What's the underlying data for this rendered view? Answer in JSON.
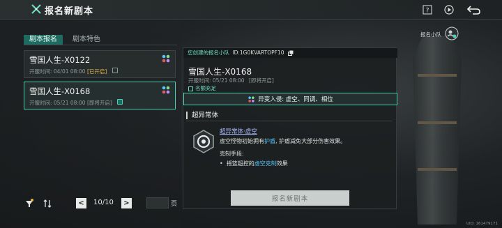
{
  "header": {
    "title": "报名新剧本",
    "help_label": "?",
    "icons": [
      "logo-icon",
      "help-icon",
      "play-icon",
      "back-icon"
    ]
  },
  "tabs": [
    {
      "label": "剧本报名",
      "active": true
    },
    {
      "label": "剧本特色",
      "active": false
    }
  ],
  "scripts": [
    {
      "name": "雪国人生-X0122",
      "time": "开服时间: 04/01 08:00",
      "status": "[已开启]",
      "status_color": "#e6b640",
      "selected": false
    },
    {
      "name": "雪国人生-X0168",
      "time": "开服时间: 05/21 08:00",
      "status": "[即将开启]",
      "status_color": "#8f9b98",
      "selected": true
    }
  ],
  "pager": {
    "text": "10/10",
    "prev": "<",
    "next": ">",
    "input_value": "",
    "unit": "页"
  },
  "detail": {
    "team_label": "您创建的报名小队",
    "team_id": "ID:1G0KVARTOPF10",
    "name": "雪国人生-X0168",
    "time": "开服时间: 05/21 08:00",
    "status": "[即将开启]",
    "slot": "名额充足",
    "anomaly": "异变入侵: 虚空、同调、相位",
    "section_title": "超异常体",
    "anomaly_name": "超异常体·虚空",
    "desc_prefix": "虚空怪物初始拥有",
    "desc_hl": "护盾",
    "desc_suffix": ", 护盾减免大部分伤害效果。",
    "counter_title": "克制手段:",
    "counter_bullet": "•",
    "counter_prefix": "摇篮超控的",
    "counter_hl": "虚空克制",
    "counter_suffix": "效果",
    "register_button": "报名新剧本"
  },
  "side": {
    "team_label": "报名小队"
  },
  "uid": "UID: 161479171",
  "colors": {
    "accent": "#4fd1b8",
    "highlight": "#53c7ff",
    "link": "#a9b8ff"
  }
}
